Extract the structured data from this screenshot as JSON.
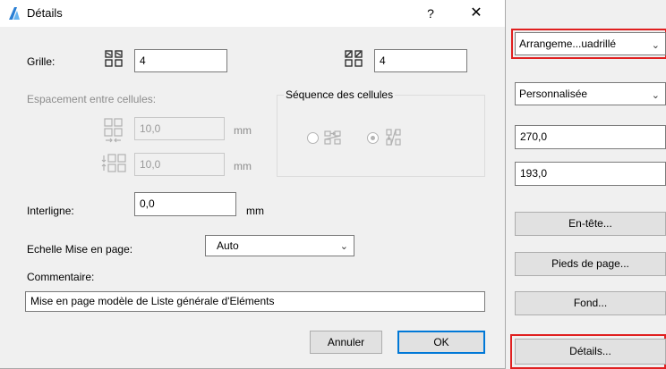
{
  "dialog": {
    "title": "Détails",
    "help_label": "?",
    "close_label": "✕",
    "grid": {
      "label": "Grille:",
      "columns_value": "4",
      "rows_value": "4"
    },
    "spacing": {
      "label": "Espacement entre cellules:",
      "horizontal_value": "10,0",
      "vertical_value": "10,0",
      "unit": "mm"
    },
    "sequence": {
      "label": "Séquence des cellules",
      "options": [
        "row-first",
        "column-first"
      ],
      "selected": "column-first"
    },
    "line_spacing": {
      "label": "Interligne:",
      "value": "0,0",
      "unit": "mm"
    },
    "layout_scale": {
      "label": "Echelle Mise en page:",
      "value": "Auto"
    },
    "comment": {
      "label": "Commentaire:",
      "value": "Mise en page modèle de Liste générale d'Eléments"
    },
    "buttons": {
      "cancel": "Annuler",
      "ok": "OK"
    }
  },
  "right_panel": {
    "arrangement_value": "Arrangeme...uadrillé",
    "format_value": "Personnalisée",
    "width_value": "270,0",
    "height_value": "193,0",
    "header_button": "En-tête...",
    "footer_button": "Pieds de page...",
    "background_button": "Fond...",
    "details_button": "Détails..."
  },
  "colors": {
    "highlight": "#e02020",
    "default_button_border": "#0078d7",
    "disabled_text": "#8c8c8c"
  },
  "icons": [
    "app-logo-icon",
    "grid-columns-icon",
    "grid-rows-icon",
    "spacing-horizontal-icon",
    "spacing-vertical-icon",
    "sequence-row-icon",
    "sequence-column-icon",
    "chevron-down-icon"
  ]
}
